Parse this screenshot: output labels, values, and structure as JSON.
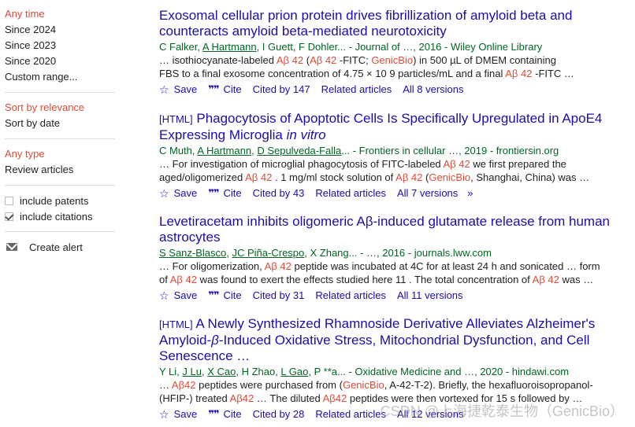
{
  "sidebar": {
    "time_items": [
      "Any time",
      "Since 2024",
      "Since 2023",
      "Since 2020",
      "Custom range..."
    ],
    "sort_items": [
      "Sort by relevance",
      "Sort by date"
    ],
    "type_items": [
      "Any type",
      "Review articles"
    ],
    "include_patents": "include patents",
    "include_citations": "include citations",
    "create_alert": "Create alert"
  },
  "results": [
    {
      "tag": "",
      "title_parts": [
        "Exosomal cellular prion protein drives fibrillization of amyloid beta and counteracts amyloid beta-mediated neurotoxicity"
      ],
      "authors_pre": "C Falker, ",
      "authors_link": "A Hartmann",
      "authors_post": ", I Guett, F Dohler... - Journal of …, 2016 - Wiley Online Library",
      "snippet1_parts": [
        "… isothiocyanate-labeled ",
        "Aβ 42",
        " (",
        "Aβ 42",
        " -FITC; ",
        "GenicBio",
        ") in 500 µL of DMEM containing"
      ],
      "snippet2_parts": [
        "FBS to a final exosome concentration of 4.75 × 10 9 particles/mL and a final ",
        "Aβ 42",
        " -FITC …"
      ],
      "save": "Save",
      "cite": "Cite",
      "cited_by": "Cited by 147",
      "related": "Related articles",
      "versions": "All 8 versions"
    },
    {
      "tag": "[HTML]",
      "title_parts": [
        "Phagocytosis of Apoptotic Cells Is Specifically Upregulated in ApoE4 Expressing Microglia ",
        "in vitro"
      ],
      "authors_pre": "C Muth, ",
      "authors_link": "A Hartmann",
      "authors_mid": ", ",
      "authors_link2": "D Sepulveda-Falla",
      "authors_post": "... - Frontiers in cellular …, 2019 - frontiersin.org",
      "snippet1_parts": [
        "… For investigation of microglial phagocytosis of FITC-labeled ",
        "Aβ 42",
        " we first prepared the"
      ],
      "snippet2_parts": [
        "aged/oligomerized ",
        "Aβ 42",
        " . 1 mg/ml stock solution of ",
        "Aβ 42",
        " (",
        "GenicBio",
        ", Shanghai, China) was …"
      ],
      "save": "Save",
      "cite": "Cite",
      "cited_by": "Cited by 43",
      "related": "Related articles",
      "versions": "All 7 versions"
    },
    {
      "tag": "",
      "title_parts": [
        "Levetiracetam inhibits oligomeric Aβ-induced glutamate release from human astrocytes"
      ],
      "authors_link": "S Sanz-Blasco",
      "authors_mid": ", ",
      "authors_link2": "JC Piña-Crespo",
      "authors_post": ", X Zhang... - …, 2016 - journals.lww.com",
      "snippet1_parts": [
        "… For oligomerization, ",
        "Aβ 42",
        " peptide was incubated at 4C for at least 24 h and sonicated … form"
      ],
      "snippet2_parts": [
        "of ",
        "Aβ 42",
        " was found to exert the effects studied here 11 . The total concentration of ",
        "Aβ 42",
        " was …"
      ],
      "save": "Save",
      "cite": "Cite",
      "cited_by": "Cited by 31",
      "related": "Related articles",
      "versions": "All 11 versions"
    },
    {
      "tag": "[HTML]",
      "title_parts": [
        "A Newly Synthesized Rhamnoside Derivative Alleviates Alzheimer's Amyloid-",
        "β",
        "-Induced Oxidative Stress, Mitochondrial Dysfunction, and Cell Senescence …"
      ],
      "authors_pre": "Y Li, ",
      "authors_link": "J Lu",
      "authors_mid": ", ",
      "authors_link2": "X Cao",
      "authors_mid2": ", H Zhao, ",
      "authors_link3": "L Gao",
      "authors_post": ", P **a... - Oxidative Medicine and …, 2020 - hindawi.com",
      "snippet1_parts": [
        "… ",
        "Aβ42",
        " peptides were purchased from (",
        "GenicBio",
        ", A-42-T-2). Briefly, the hexafluoroisopropanol-"
      ],
      "snippet2_parts": [
        "(HFIP-) treated ",
        "Aβ42",
        " … The diluted ",
        "Aβ42",
        " peptides were then vortexed for 15 s followed by …"
      ],
      "save": "Save",
      "cite": "Cite",
      "cited_by": "Cited by 28",
      "related": "Related articles",
      "versions": "All 12 versions"
    }
  ],
  "watermark": "CSDN @上海捷乾泰生物（GenicBio）",
  "icons": {
    "star": "star-icon",
    "quote": "quote-icon",
    "more": "double-chevron-icon",
    "mail": "mail-icon"
  },
  "colors": {
    "selected": "#dd4b39",
    "link": "#1a0dab",
    "source": "#006621",
    "highlight": "#dd4b39"
  }
}
